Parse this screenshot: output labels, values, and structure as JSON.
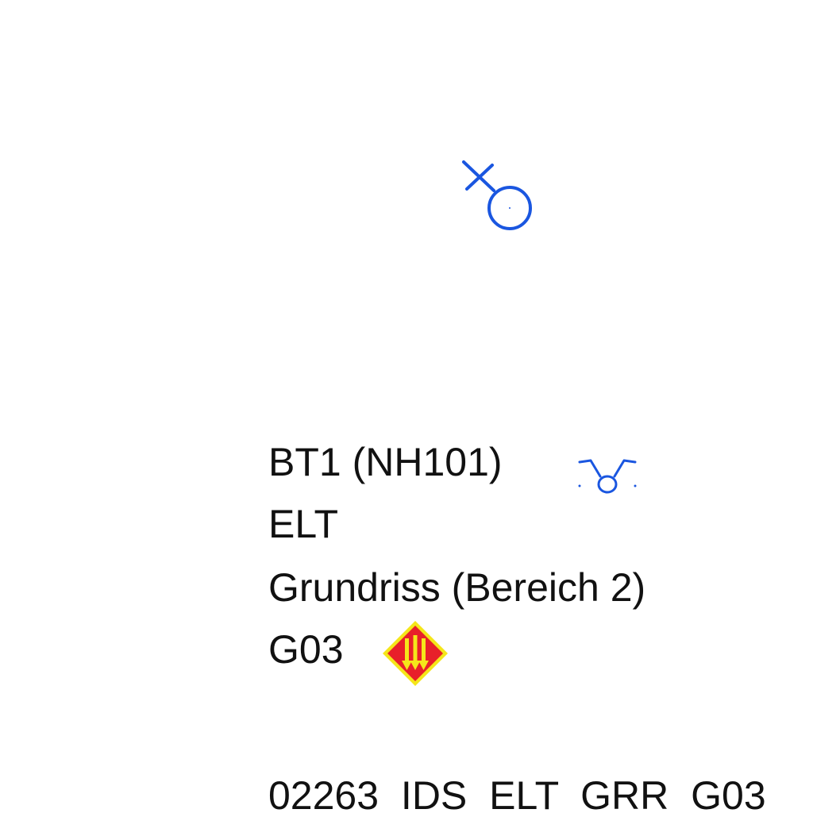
{
  "title_block": {
    "line_1": "BT1 (NH101)",
    "line_2": "ELT",
    "line_3": "Grundriss (Bereich 2)",
    "line_4": "G03",
    "drawing_code": "02263  IDS  ELT  GRR  G03"
  },
  "symbols": {
    "luminaire": "luminaire-cross-circle-icon",
    "outlet": "outlet-symbol-icon",
    "hazard": "electrical-hazard-diamond-icon"
  },
  "colors": {
    "text": "#111111",
    "symbol_blue": "#1a56e0",
    "hazard_red": "#e8202a",
    "hazard_yellow": "#f5e61a"
  }
}
